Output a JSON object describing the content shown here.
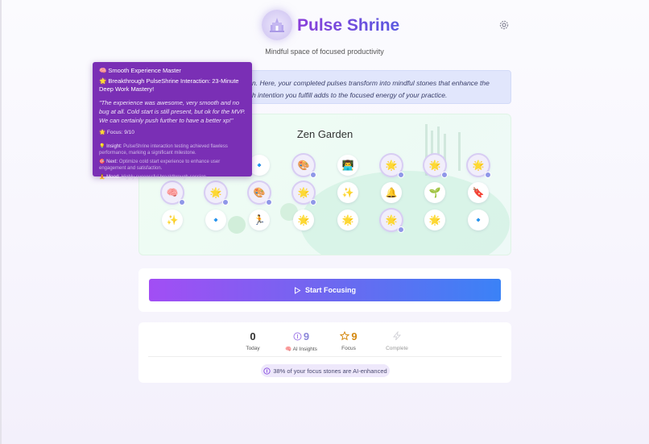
{
  "app": {
    "title": "Pulse Shrine",
    "subtitle": "Mindful space of focused productivity"
  },
  "intro": {
    "line1": "n. Here, your completed pulses transform into mindful stones that enhance the",
    "line2": "h intention you fulfill adds to the focused energy of your practice."
  },
  "garden": {
    "title": "Zen Garden",
    "rows": [
      [
        {
          "g": "🔹",
          "ai": false
        },
        {
          "g": "🎨",
          "ai": true
        },
        {
          "g": "👨‍💻",
          "ai": false
        },
        {
          "g": "🌟",
          "ai": true
        },
        {
          "g": "🌟",
          "ai": true
        },
        {
          "g": "🌟",
          "ai": true
        }
      ],
      [
        {
          "g": "🧠",
          "ai": true
        },
        {
          "g": "🌟",
          "ai": true
        },
        {
          "g": "🎨",
          "ai": true
        },
        {
          "g": "🌟",
          "ai": true
        },
        {
          "g": "✨",
          "ai": false
        },
        {
          "g": "🔔",
          "ai": false
        },
        {
          "g": "🌱",
          "ai": false
        },
        {
          "g": "🔖",
          "ai": false
        }
      ],
      [
        {
          "g": "✨",
          "ai": false
        },
        {
          "g": "🔹",
          "ai": false
        },
        {
          "g": "🏃",
          "ai": false
        },
        {
          "g": "🌟",
          "ai": false
        },
        {
          "g": "🌟",
          "ai": false
        },
        {
          "g": "🌟",
          "ai": true
        },
        {
          "g": "🌟",
          "ai": false
        },
        {
          "g": "🔹",
          "ai": false
        }
      ]
    ]
  },
  "tooltip": {
    "heading": "🧠 Smooth Experience Master",
    "title": "🌟 Breakthrough PulseShrine Interaction: 23-Minute Deep Work Mastery!",
    "quote": "\"The experience was awesome, very smooth and no bug at all. Cold start is still present, but ok for the MVP. We can certainly push further to have a better xp!\"",
    "focus": "🌟 Focus: 9/10",
    "insight_label": "💡 Insight:",
    "insight_text": "PulseShrine interaction testing achieved flawless performance, marking a significant milestone.",
    "next_label": "🎯 Next:",
    "next_text": "Optimize cold start experience to enhance user engagement and satisfaction.",
    "mood_label": "🧘 Mood:",
    "mood_text": "Highly successful breakthrough session."
  },
  "actions": {
    "start_label": "Start Focusing"
  },
  "stats": {
    "today": {
      "value": "0",
      "label": "Today"
    },
    "ai": {
      "value": "9",
      "label": "🧠 AI Insights"
    },
    "focus": {
      "value": "9",
      "label": "Focus"
    },
    "complete": {
      "value": "",
      "label": "Complete"
    }
  },
  "summary": {
    "text": "38% of your focus stones are AI-enhanced"
  },
  "colors": {
    "accent_purple": "#8a3fd9",
    "accent_blue": "#3b82f6",
    "tooltip_bg": "#7a2fb5",
    "focus_star": "#d4880f"
  }
}
